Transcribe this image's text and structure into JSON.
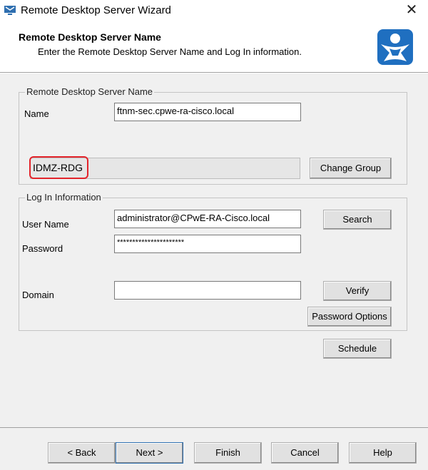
{
  "window": {
    "title": "Remote Desktop Server Wizard",
    "close_glyph": "✕"
  },
  "header": {
    "title": "Remote Desktop Server Name",
    "subtitle": "Enter the Remote Desktop Server Name and Log In information."
  },
  "server_group": {
    "legend": "Remote Desktop Server Name",
    "name_label": "Name",
    "name_value": "ftnm-sec.cpwe-ra-cisco.local",
    "group_value": "IDMZ-RDG",
    "change_group_label": "Change Group"
  },
  "login_group": {
    "legend": "Log In Information",
    "username_label": "User Name",
    "username_value": "administrator@CPwE-RA-Cisco.local",
    "password_label": "Password",
    "password_value": "**********************",
    "domain_label": "Domain",
    "domain_value": "",
    "search_label": "Search",
    "verify_label": "Verify",
    "password_options_label": "Password Options",
    "schedule_label": "Schedule"
  },
  "footer": {
    "back_label": "< Back",
    "next_label": "Next >",
    "finish_label": "Finish",
    "cancel_label": "Cancel",
    "help_label": "Help"
  },
  "colors": {
    "highlight": "#e3242b",
    "logo_blue": "#1f6fc0"
  },
  "icons": {
    "app": "computer-icon",
    "logo": "thinmanager-logo-icon"
  }
}
